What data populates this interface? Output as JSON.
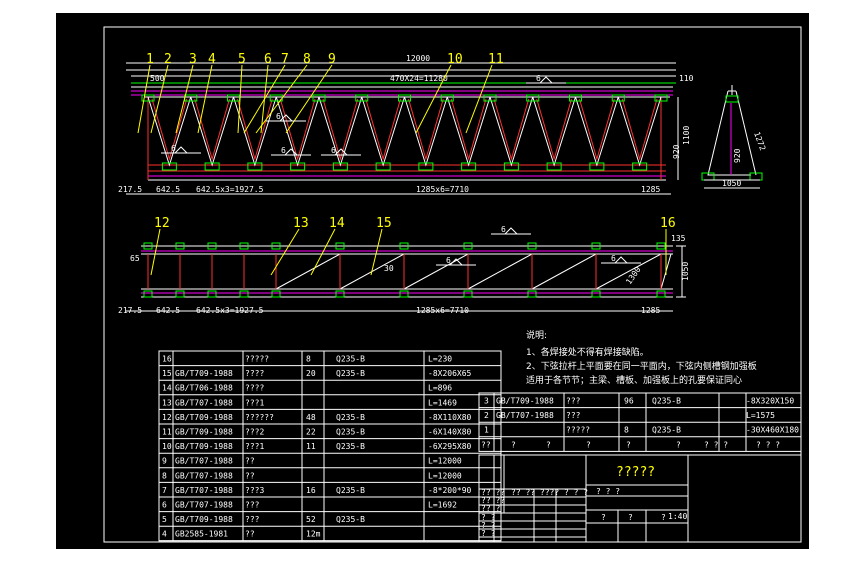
{
  "callouts_top": [
    "1",
    "2",
    "3",
    "4",
    "5",
    "6",
    "7",
    "8",
    "9",
    "10",
    "11"
  ],
  "callouts_bottom": [
    "12",
    "13",
    "14",
    "15",
    "16"
  ],
  "elev_dims": {
    "top_total": "12000",
    "top_left": "500",
    "top_mid": "470X24=11280",
    "top_right": "110",
    "bottom_1": "217.5",
    "bottom_2": "642.5",
    "bottom_3": "642.5x3=1927.5",
    "bottom_4": "1285x6=7710",
    "bottom_5": "1285",
    "height": "1100",
    "height2": "920",
    "section_width": "1050",
    "section_slope": "1272",
    "section_h": "920"
  },
  "plan_dims": {
    "left_small": "65",
    "mid": "30",
    "right_top": "135",
    "right_h": "1050",
    "right_diag": "1300",
    "bottom_1": "217.5",
    "bottom_2": "642.5",
    "bottom_3": "642.5x3=1927.5",
    "bottom_4": "1285x6=7710",
    "bottom_5": "1285"
  },
  "weld_symbols": [
    "6",
    "6",
    "6",
    "6",
    "6",
    "6",
    "6",
    "6"
  ],
  "notes": {
    "title": "说明:",
    "line1": "1、各焊接处不得有焊接缺陷。",
    "line2": "2、下弦拉杆上平面要在同一平面内，下弦内侧槽钢加强板",
    "line3": "适用于各节节；主梁、槽板、加强板上的孔要保证同心"
  },
  "bom_left": [
    {
      "no": "16",
      "std": "",
      "name": "?????",
      "qty": "8",
      "mat": "Q235-B",
      "spec": "L=230"
    },
    {
      "no": "15",
      "std": "GB/T709-1988",
      "name": "????",
      "qty": "20",
      "mat": "Q235-B",
      "spec": "-8X206X65"
    },
    {
      "no": "14",
      "std": "GB/T706-1988",
      "name": "????",
      "qty": "",
      "mat": "",
      "spec": "L=896"
    },
    {
      "no": "13",
      "std": "GB/T707-1988",
      "name": "???1",
      "qty": "",
      "mat": "",
      "spec": "L=1469"
    },
    {
      "no": "12",
      "std": "GB/T709-1988",
      "name": "??????",
      "qty": "48",
      "mat": "Q235-B",
      "spec": "-8X110X80"
    },
    {
      "no": "11",
      "std": "GB/T709-1988",
      "name": "???2",
      "qty": "22",
      "mat": "Q235-B",
      "spec": "-6X140X80"
    },
    {
      "no": "10",
      "std": "GB/T709-1988",
      "name": "???1",
      "qty": "11",
      "mat": "Q235-B",
      "spec": "-6X295X80"
    },
    {
      "no": "9",
      "std": "GB/T707-1988",
      "name": "??",
      "qty": "",
      "mat": "",
      "spec": "L=12000"
    },
    {
      "no": "8",
      "std": "GB/T707-1988",
      "name": "??",
      "qty": "",
      "mat": "",
      "spec": "L=12000"
    },
    {
      "no": "7",
      "std": "GB/T707-1988",
      "name": "???3",
      "qty": "16",
      "mat": "Q235-B",
      "spec": "-8*200*90"
    },
    {
      "no": "6",
      "std": "GB/T707-1988",
      "name": "???",
      "qty": "",
      "mat": "",
      "spec": "L=1692"
    },
    {
      "no": "5",
      "std": "GB/T709-1988",
      "name": "???",
      "qty": "52",
      "mat": "Q235-B",
      "spec": ""
    },
    {
      "no": "4",
      "std": "GB2585-1981",
      "name": "??",
      "qty": "12m",
      "mat": "",
      "spec": ""
    }
  ],
  "bom_right": [
    {
      "no": "3",
      "std": "GB/T709-1988",
      "name": "???",
      "qty": "96",
      "mat": "Q235-B",
      "spec": "-8X320X150"
    },
    {
      "no": "2",
      "std": "GB/T707-1988",
      "name": "???",
      "qty": "",
      "mat": "",
      "spec": "L=1575"
    },
    {
      "no": "1",
      "std": "",
      "name": "?????",
      "qty": "8",
      "mat": "Q235-B",
      "spec": "-30X460X180"
    }
  ],
  "bom_header": {
    "a": "??",
    "b": "?",
    "c": "?",
    "d": "?",
    "e": "?",
    "f": "?",
    "g": "? ? ?",
    "h": "? ? ?"
  },
  "title_block": {
    "title": "?????",
    "row_a": "? ? ?",
    "row_b": "?? ??  ????  ?  ? ?",
    "row_c": "? ?",
    "row_d": "? ?",
    "row_e": "? ?",
    "sheet_1": "?",
    "sheet_2": "?",
    "sheet_3": "?",
    "scale": "1:40",
    "small_a": "?? ??",
    "small_b": "?? ??",
    "small_c": "?? ?"
  }
}
